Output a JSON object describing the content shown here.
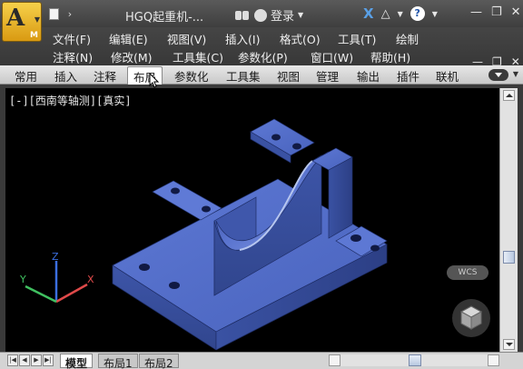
{
  "app": {
    "logo_letter": "A",
    "logo_sub": "M",
    "title": "HGQ起重机-...",
    "login": "登录"
  },
  "menu": {
    "row1": [
      "文件(F)",
      "编辑(E)",
      "视图(V)",
      "插入(I)",
      "格式(O)",
      "工具(T)",
      "绘制"
    ],
    "row2": [
      "注释(N)",
      "修改(M)",
      "工具集(C)",
      "参数化(P)",
      "窗口(W)",
      "帮助(H)"
    ]
  },
  "ribbon": {
    "tabs": [
      "常用",
      "插入",
      "注释",
      "布局",
      "参数化",
      "工具集",
      "视图",
      "管理",
      "输出",
      "插件",
      "联机"
    ],
    "active_tab": "布局"
  },
  "viewport": {
    "label": "[-][西南等轴测][真实]",
    "wcs": "WCS",
    "ucs_axes": [
      "X",
      "Y",
      "Z"
    ],
    "model_color": "#4a64c0"
  },
  "layout_tabs": [
    "模型",
    "布局1",
    "布局2"
  ],
  "active_layout_tab": "模型"
}
